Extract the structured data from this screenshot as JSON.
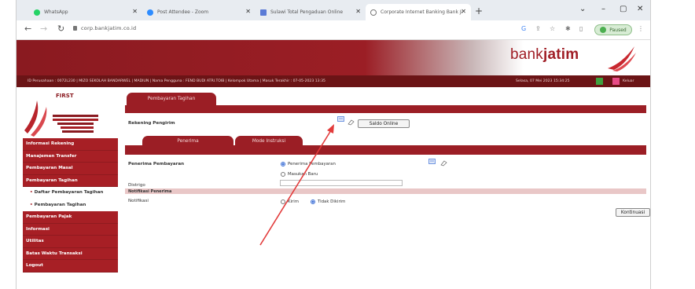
{
  "browser": {
    "tabs": [
      {
        "title": "WhatsApp",
        "color": "#25d366",
        "active": false
      },
      {
        "title": "Post Attendee - Zoom",
        "color": "#2d8cff",
        "active": false
      },
      {
        "title": "Sulawi Total Pengaduan Online",
        "color": "#5b7bd6",
        "active": false
      },
      {
        "title": "Corporate Internet Banking Bank Jatim",
        "color": "#888888",
        "active": true
      }
    ],
    "url": "corp.bankjatim.co.id",
    "paused_label": "Paused"
  },
  "brand": {
    "logo_light": "bank",
    "logo_bold": "jatim",
    "sidebar_title": "FIRST"
  },
  "info_bar": {
    "left_text": "ID Perusahaan : 0072L230 | MIZO SEKOLAH BANDARWEL | MADIUN | Nama Pengguna : FEND BUDI ATRI.TOIB | Kelompok Utama | Masuk Terakhir : 07-05-2023 13:35",
    "right_text": "Selasa, 07 Mei 2023   15:34:25",
    "logout": "Keluar"
  },
  "sidebar": {
    "items": [
      {
        "label": "Informasi Rekening",
        "sub": false
      },
      {
        "label": "Manajemen Transfer",
        "sub": false
      },
      {
        "label": "Pembayaran Masal",
        "sub": false
      },
      {
        "label": "Pembayaran Tagihan",
        "sub": false
      },
      {
        "label": "Daftar Pembayaran Tagihan",
        "sub": true
      },
      {
        "label": "Pembayaran Tagihan",
        "sub": true
      },
      {
        "label": "Pembayaran Pajak",
        "sub": false
      },
      {
        "label": "Informasi",
        "sub": false
      },
      {
        "label": "Utilitas",
        "sub": false
      },
      {
        "label": "Batas Waktu Transaksi",
        "sub": false
      },
      {
        "label": "Logout",
        "sub": false
      }
    ]
  },
  "main": {
    "page_tab": "Pembayaran Tagihan",
    "rekening_label": "Rekening Pengirim",
    "saldo_button": "Saldo Online",
    "tabs": [
      "Penerima",
      "Mode Instruksi"
    ],
    "penerima_label": "Penerima Pembayaran",
    "radio_option_1": "Penerima Pembayaran",
    "radio_option_2": "Masukan Baru",
    "distrigo_label": "Distrigo",
    "notifikasi_header": "Notifikasi Penerima",
    "notifikasi_label": "Notifikasi",
    "notif_yes": "Kirim",
    "notif_no": "Tidak Dikirim",
    "continue_button": "Kontinuasi"
  },
  "colors": {
    "brand_red": "#9b1e25",
    "annotation_arrow": "#e23b3b"
  }
}
